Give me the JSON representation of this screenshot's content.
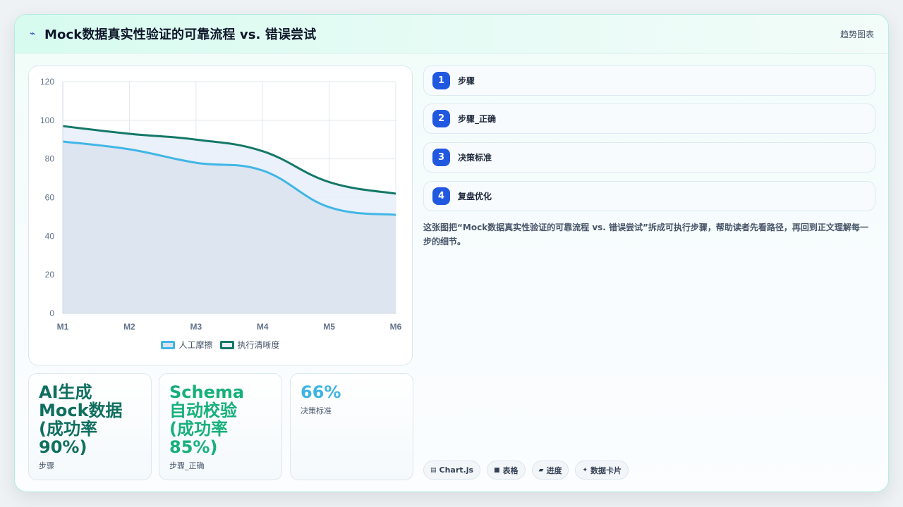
{
  "header": {
    "title": "Mock数据真实性验证的可靠流程 vs. 错误尝试",
    "tag": "趋势图表",
    "icon": "lightning-icon"
  },
  "chart_data": {
    "type": "area",
    "title": "",
    "xlabel": "",
    "ylabel": "",
    "categories": [
      "M1",
      "M2",
      "M3",
      "M4",
      "M5",
      "M6"
    ],
    "ylim": [
      0,
      120
    ],
    "yticks": [
      0,
      20,
      40,
      60,
      80,
      100,
      120
    ],
    "grid": true,
    "legend_position": "bottom",
    "series": [
      {
        "name": "人工摩擦",
        "values": [
          89,
          85,
          78,
          74,
          55,
          51
        ],
        "color": "#41b6e6",
        "fill": "#dbe3ef"
      },
      {
        "name": "执行清晰度",
        "values": [
          97,
          93,
          90,
          84,
          68,
          62
        ],
        "color": "#137868",
        "fill": "#e8effa"
      }
    ]
  },
  "stats": [
    {
      "value": "AI生成Mock数据(成功率90%)",
      "label": "步骤",
      "color": "#0f6f5f"
    },
    {
      "value": "Schema自动校验 (成功率85%)",
      "label": "步骤_正确",
      "color": "#16b07a"
    },
    {
      "value": "66%",
      "label": "决策标准",
      "color": "#3fb4e3"
    }
  ],
  "steps": [
    {
      "num": "1",
      "label": "步骤"
    },
    {
      "num": "2",
      "label": "步骤_正确"
    },
    {
      "num": "3",
      "label": "决策标准"
    },
    {
      "num": "4",
      "label": "复盘优化"
    }
  ],
  "description": "这张图把“Mock数据真实性验证的可靠流程 vs. 错误尝试”拆成可执行步骤，帮助读者先看路径，再回到正文理解每一步的细节。",
  "pills": [
    {
      "icon": "▤",
      "icon_name": "chart-icon",
      "label": "Chart.js"
    },
    {
      "icon": "■",
      "icon_name": "table-icon",
      "label": "表格"
    },
    {
      "icon": "▰",
      "icon_name": "progress-icon",
      "label": "进度"
    },
    {
      "icon": "✦",
      "icon_name": "sparkle-icon",
      "label": "数据卡片"
    }
  ]
}
